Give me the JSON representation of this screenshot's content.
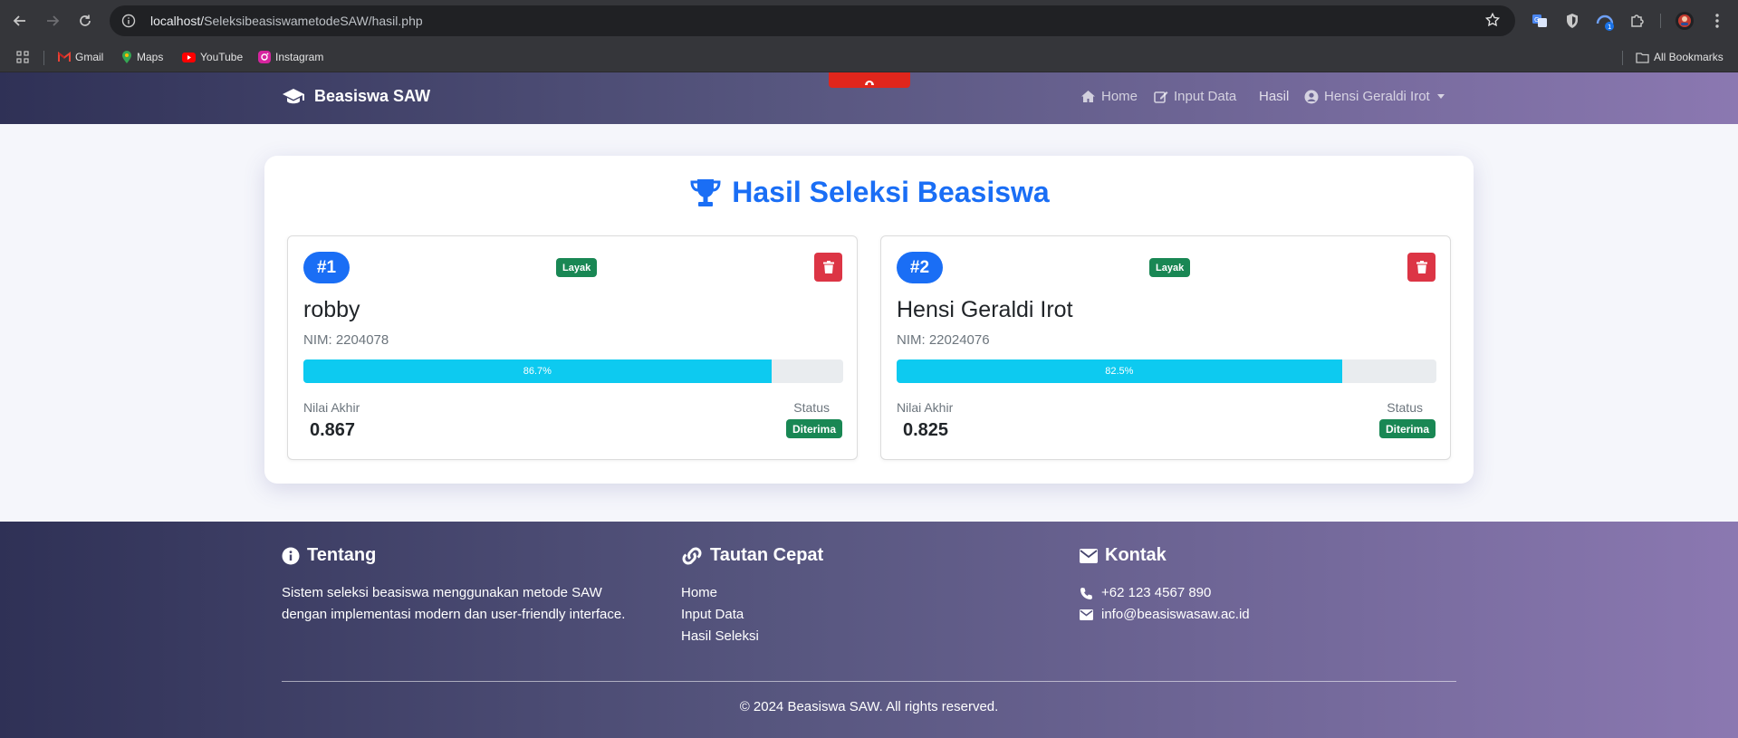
{
  "browser": {
    "url_host": "localhost/",
    "url_path": "SeleksibeasiswametodeSAW/hasil.php",
    "bookmarks": [
      "Gmail",
      "Maps",
      "YouTube",
      "Instagram"
    ],
    "all_bookmarks": "All Bookmarks",
    "ext_badge": "1"
  },
  "navbar": {
    "brand": "Beasiswa SAW",
    "links": {
      "home": "Home",
      "input": "Input Data",
      "hasil": "Hasil",
      "user": "Hensi Geraldi Irot"
    }
  },
  "main": {
    "title": "Hasil Seleksi Beasiswa",
    "results": [
      {
        "rank": "#1",
        "badge": "Layak",
        "name": "robby",
        "nim": "NIM: 2204078",
        "progress_label": "86.7%",
        "progress": 0.867,
        "score_label": "Nilai Akhir",
        "score": "0.867",
        "status_label": "Status",
        "status": "Diterima"
      },
      {
        "rank": "#2",
        "badge": "Layak",
        "name": "Hensi Geraldi Irot",
        "nim": "NIM: 22024076",
        "progress_label": "82.5%",
        "progress": 0.825,
        "score_label": "Nilai Akhir",
        "score": "0.825",
        "status_label": "Status",
        "status": "Diterima"
      }
    ]
  },
  "footer": {
    "about": {
      "title": "Tentang",
      "text_1": "Sistem seleksi beasiswa menggunakan metode SAW",
      "text_2": "dengan implementasi modern dan user-friendly interface."
    },
    "links": {
      "title": "Tautan Cepat",
      "items": [
        "Home",
        "Input Data",
        "Hasil Seleksi"
      ]
    },
    "contact": {
      "title": "Kontak",
      "phone": "+62 123 4567 890",
      "email": "info@beasiswasaw.ac.id"
    },
    "copyright": "© 2024 Beasiswa SAW. All rights reserved."
  },
  "colors": {
    "primary": "#1a6ef5",
    "success": "#198754",
    "danger": "#dc3545",
    "info": "#0dcaf0"
  }
}
